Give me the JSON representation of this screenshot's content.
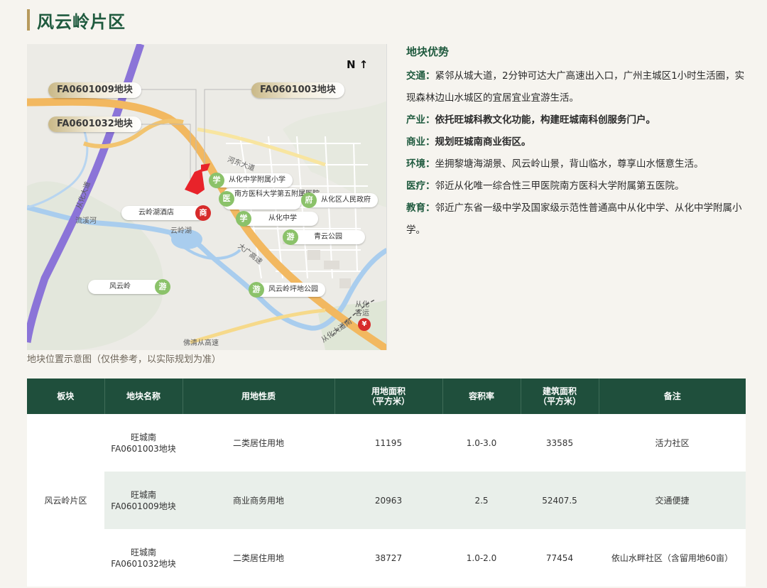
{
  "page": {
    "title": "风云岭片区"
  },
  "map": {
    "compass": "N ↑",
    "caption": "地块位置示意图（仅供参考，以实际规划为准）",
    "callouts": [
      "FA0601009地块",
      "FA0601003地块",
      "FA0601032地块"
    ],
    "pois": {
      "school1": {
        "icon": "学",
        "label": "从化中学附属小学"
      },
      "hospital": {
        "icon": "医",
        "label": "南方医科大学第五附属医院"
      },
      "gov": {
        "icon": "府",
        "label": "从化区人民政府"
      },
      "school2": {
        "icon": "学",
        "label": "从化中学"
      },
      "hotel": {
        "icon": "商",
        "label": "云岭湖酒店"
      },
      "park1": {
        "icon": "游",
        "label": "青云公园"
      },
      "park2": {
        "icon": "游",
        "label": "风云岭坪地公园"
      },
      "mountain": {
        "icon": "游",
        "label": "风云岭"
      },
      "station": {
        "icon": "¥",
        "label": "从化客运"
      }
    },
    "labels": {
      "lake": "云岭湖",
      "road1": "河东大道",
      "road2": "大广高速",
      "road3": "从化大道",
      "road4": "街北高速",
      "river": "流溪河",
      "road5": "佛清从高速",
      "road6": "从化大道南"
    }
  },
  "advantages": {
    "title": "地块优势",
    "items": [
      {
        "key": "交通：",
        "text": "紧邻从城大道，2分钟可达大广高速出入口，广州主城区1小时生活圈，实现森林边山水城区的宜居宜业宜游生活。",
        "bold": false
      },
      {
        "key": "产业：",
        "text": "依托旺城科教文化功能，构建旺城南科创服务门户。",
        "bold": true
      },
      {
        "key": "商业：",
        "text": "规划旺城南商业街区。",
        "bold": true
      },
      {
        "key": "环境：",
        "text": "坐拥黎塘海湖景、风云岭山景，背山临水，尊享山水惬意生活。",
        "bold": false
      },
      {
        "key": "医疗：",
        "text": "邻近从化唯一综合性三甲医院南方医科大学附属第五医院。",
        "bold": false
      },
      {
        "key": "教育：",
        "text": "邻近广东省一级中学及国家级示范性普通高中从化中学、从化中学附属小学。",
        "bold": false
      }
    ]
  },
  "table": {
    "headers": [
      "板块",
      "地块名称",
      "用地性质",
      "用地面积\n（平方米）",
      "容积率",
      "建筑面积\n（平方米）",
      "备注"
    ],
    "region": "风云岭片区",
    "rows": [
      {
        "name": "旺城南\nFA0601003地块",
        "use": "二类居住用地",
        "area": "11195",
        "far": "1.0-3.0",
        "floor": "33585",
        "note": "活力社区"
      },
      {
        "name": "旺城南\nFA0601009地块",
        "use": "商业商务用地",
        "area": "20963",
        "far": "2.5",
        "floor": "52407.5",
        "note": "交通便捷"
      },
      {
        "name": "旺城南\nFA0601032地块",
        "use": "二类居住用地",
        "area": "38727",
        "far": "1.0-2.0",
        "floor": "77454",
        "note": "依山水畔社区（含留用地60亩）"
      }
    ]
  },
  "colors": {
    "brand_green": "#1f5a3e",
    "header_green": "#1f4f3c",
    "gold": "#b79a5c",
    "parcel_red": "#e8232a"
  }
}
